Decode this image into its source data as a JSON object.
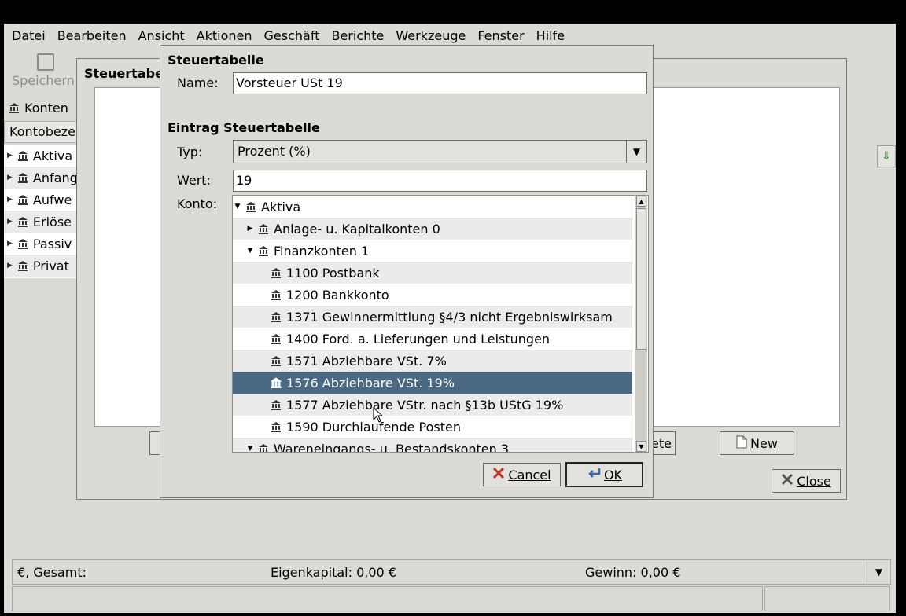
{
  "menu": [
    {
      "label": "Datei"
    },
    {
      "label": "Bearbeiten"
    },
    {
      "label": "Ansicht"
    },
    {
      "label": "Aktionen"
    },
    {
      "label": "Geschäft"
    },
    {
      "label": "Berichte"
    },
    {
      "label": "Werkzeuge"
    },
    {
      "label": "Fenster"
    },
    {
      "label": "Hilfe"
    }
  ],
  "toolbar": {
    "save_label": "Speichern"
  },
  "tab": {
    "label": "Konten"
  },
  "account_header": "Kontobeze",
  "accounts": [
    {
      "label": "Aktiva"
    },
    {
      "label": "Anfang"
    },
    {
      "label": "Aufwe"
    },
    {
      "label": "Erlöse"
    },
    {
      "label": "Passiv"
    },
    {
      "label": "Privat"
    }
  ],
  "status": {
    "total": "€, Gesamt:",
    "equity": "Eigenkapital: 0,00 €",
    "profit": "Gewinn: 0,00 €"
  },
  "back_dialog": {
    "title": "Steuertabe",
    "delete_label": "ete",
    "new_label": "New",
    "close_label": "Close"
  },
  "dialog": {
    "section1": "Steuertabelle",
    "name_label": "Name:",
    "name_value": "Vorsteuer USt 19",
    "section2": "Eintrag Steuertabelle",
    "type_label": "Typ:",
    "type_value": "Prozent (%)",
    "value_label": "Wert:",
    "value_value": "19",
    "account_label": "Konto:",
    "cancel_label": "Cancel",
    "ok_label": "OK"
  },
  "tree": [
    {
      "label": "Aktiva",
      "level": 0,
      "exp": "open"
    },
    {
      "label": "Anlage- u. Kapitalkonten 0",
      "level": 1,
      "exp": "closed"
    },
    {
      "label": "Finanzkonten 1",
      "level": 1,
      "exp": "open"
    },
    {
      "label": "1100 Postbank",
      "level": 2,
      "exp": "none"
    },
    {
      "label": "1200 Bankkonto",
      "level": 2,
      "exp": "none"
    },
    {
      "label": "1371 Gewinnermittlung §4/3 nicht Ergebniswirksam",
      "level": 2,
      "exp": "none"
    },
    {
      "label": "1400 Ford. a. Lieferungen und Leistungen",
      "level": 2,
      "exp": "none"
    },
    {
      "label": "1571 Abziehbare VSt. 7%",
      "level": 2,
      "exp": "none"
    },
    {
      "label": "1576 Abziehbare VSt. 19%",
      "level": 2,
      "exp": "none",
      "selected": true
    },
    {
      "label": "1577 Abziehbare VStr. nach §13b UStG 19%",
      "level": 2,
      "exp": "none"
    },
    {
      "label": "1590 Durchlaufende Posten",
      "level": 2,
      "exp": "none"
    },
    {
      "label": "Wareneingangs- u. Bestandskonten 3",
      "level": 1,
      "exp": "open"
    }
  ],
  "colors": {
    "selection": "#4b6983",
    "window": "#dcdad5"
  }
}
